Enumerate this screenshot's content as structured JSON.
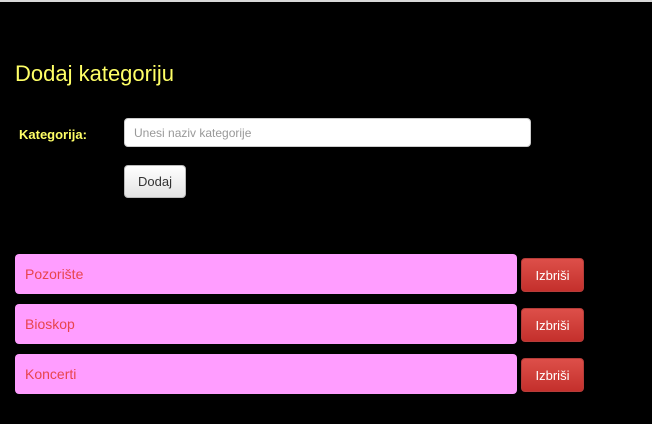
{
  "form": {
    "title": "Dodaj kategoriju",
    "category_label": "Kategorija:",
    "category_input": {
      "value": "",
      "placeholder": "Unesi naziv kategorije"
    },
    "add_button_label": "Dodaj"
  },
  "categories": [
    {
      "name": "Pozorište",
      "delete_label": "Izbriši"
    },
    {
      "name": "Bioskop",
      "delete_label": "Izbriši"
    },
    {
      "name": "Koncerti",
      "delete_label": "Izbriši"
    }
  ],
  "colors": {
    "background": "#000000",
    "heading": "#ffff66",
    "category_item_bg": "#ff9dff",
    "category_item_text": "#e8454d",
    "delete_button": "#d9534f"
  }
}
